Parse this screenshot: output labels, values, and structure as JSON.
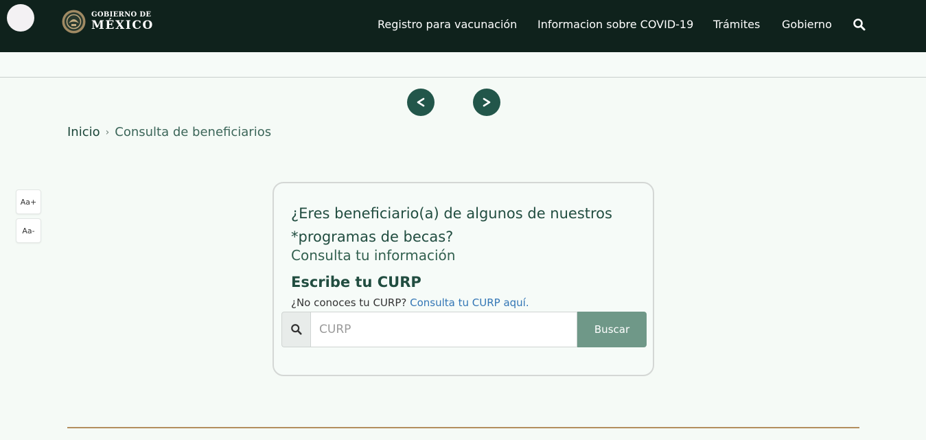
{
  "header": {
    "logo_line1": "GOBIERNO DE",
    "logo_line2": "MÉXICO",
    "nav": [
      {
        "label": "Registro para vacunación"
      },
      {
        "label": "Informacion sobre COVID-19"
      },
      {
        "label": "Trámites"
      },
      {
        "label": "Gobierno"
      }
    ],
    "search_icon": "search-icon"
  },
  "carousel": {
    "prev_symbol": "<",
    "next_symbol": ">"
  },
  "breadcrumb": {
    "home": "Inicio",
    "separator": "›",
    "current": "Consulta de beneficiarios"
  },
  "font_controls": {
    "increase": "Aa+",
    "decrease": "Aa-"
  },
  "card": {
    "question": "¿Eres beneficiario(a) de algunos de nuestros *programas de becas?",
    "subtitle": "Consulta tu información",
    "heading": "Escribe tu CURP",
    "help_text": "¿No conoces tu CURP?",
    "help_link": "Consulta tu CURP aquí.",
    "input_placeholder": "CURP",
    "input_value": "",
    "button_label": "Buscar"
  },
  "colors": {
    "header_bg": "#0f221c",
    "accent_green": "#22564a",
    "button_green": "#6f9888",
    "gold": "#b38e5d",
    "link": "#3376b5"
  }
}
